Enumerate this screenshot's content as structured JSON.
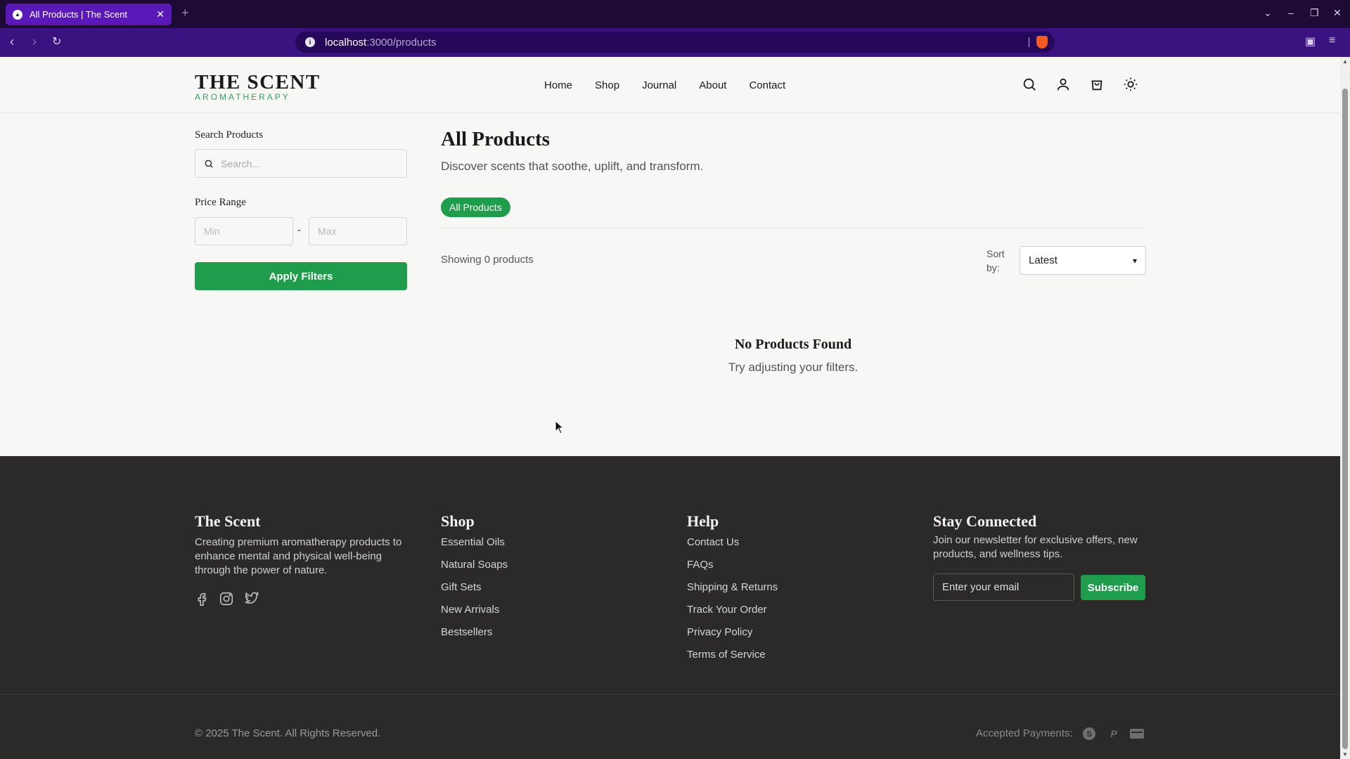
{
  "browser": {
    "tab_title": "All Products | The Scent",
    "url_host": "localhost",
    "url_path": ":3000/products"
  },
  "header": {
    "logo_main": "THE SCENT",
    "logo_sub": "AROMATHERAPY",
    "nav": [
      "Home",
      "Shop",
      "Journal",
      "About",
      "Contact"
    ]
  },
  "sidebar": {
    "search_label": "Search Products",
    "search_placeholder": "Search...",
    "price_label": "Price Range",
    "min_placeholder": "Min",
    "max_placeholder": "Max",
    "separator": "-",
    "apply_label": "Apply Filters"
  },
  "main": {
    "title": "All Products",
    "subtitle": "Discover scents that soothe, uplift, and transform.",
    "category_pill": "All Products",
    "showing": "Showing 0 products",
    "sort_label": "Sort by:",
    "sort_value": "Latest",
    "empty_title": "No Products Found",
    "empty_sub": "Try adjusting your filters."
  },
  "footer": {
    "brand_title": "The Scent",
    "brand_desc": "Creating premium aromatherapy products to enhance mental and physical well-being through the power of nature.",
    "shop_title": "Shop",
    "shop_links": [
      "Essential Oils",
      "Natural Soaps",
      "Gift Sets",
      "New Arrivals",
      "Bestsellers"
    ],
    "help_title": "Help",
    "help_links": [
      "Contact Us",
      "FAQs",
      "Shipping & Returns",
      "Track Your Order",
      "Privacy Policy",
      "Terms of Service"
    ],
    "news_title": "Stay Connected",
    "news_desc": "Join our newsletter for exclusive offers, new products, and wellness tips.",
    "email_placeholder": "Enter your email",
    "subscribe_label": "Subscribe",
    "copyright": "© 2025 The Scent. All Rights Reserved.",
    "payments_label": "Accepted Payments:",
    "payment_icons": [
      "stripe-icon",
      "paypal-icon",
      "card-icon"
    ]
  },
  "colors": {
    "brand_green": "#1f9d4c",
    "footer_bg": "#2b2a28",
    "browser_tab": "#5a18b8",
    "browser_bar": "#3b1380"
  }
}
